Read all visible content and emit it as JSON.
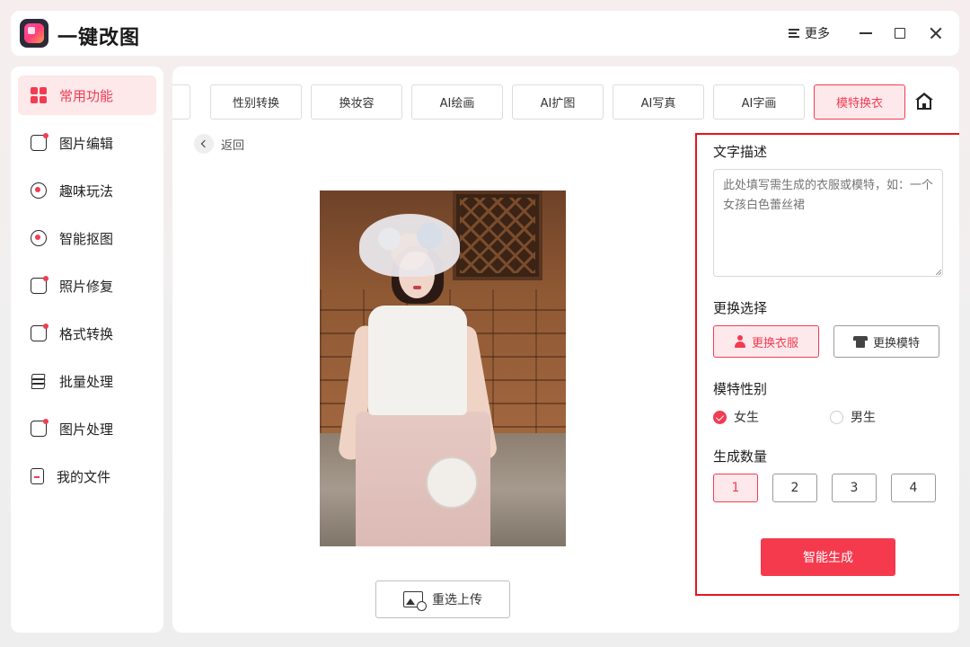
{
  "app": {
    "title": "一键改图",
    "more_label": "更多"
  },
  "sidebar": {
    "items": [
      {
        "label": "常用功能",
        "icon": "grid-icon",
        "active": true
      },
      {
        "label": "图片编辑",
        "icon": "edit-icon"
      },
      {
        "label": "趣味玩法",
        "icon": "magic-wand-icon"
      },
      {
        "label": "智能抠图",
        "icon": "target-icon"
      },
      {
        "label": "照片修复",
        "icon": "repair-icon"
      },
      {
        "label": "格式转换",
        "icon": "convert-icon"
      },
      {
        "label": "批量处理",
        "icon": "layers-icon"
      },
      {
        "label": "图片处理",
        "icon": "image-icon"
      },
      {
        "label": "我的文件",
        "icon": "file-icon"
      }
    ]
  },
  "tabs": [
    {
      "label": "性别转换"
    },
    {
      "label": "换妆容"
    },
    {
      "label": "AI绘画"
    },
    {
      "label": "AI扩图"
    },
    {
      "label": "AI写真"
    },
    {
      "label": "AI字画"
    },
    {
      "label": "模特换衣",
      "active": true
    }
  ],
  "back_label": "返回",
  "reupload_label": "重选上传",
  "settings": {
    "text_desc_title": "文字描述",
    "text_desc_placeholder": "此处填写需生成的衣服或模特，如：一个女孩白色蕾丝裙",
    "replace_title": "更换选择",
    "replace_options": [
      {
        "label": "更换衣服",
        "icon": "person-icon",
        "active": true
      },
      {
        "label": "更换模特",
        "icon": "shirt-icon"
      }
    ],
    "gender_title": "模特性别",
    "genders": [
      {
        "label": "女生",
        "checked": true
      },
      {
        "label": "男生",
        "checked": false
      }
    ],
    "count_title": "生成数量",
    "counts": [
      "1",
      "2",
      "3",
      "4"
    ],
    "selected_count": "1",
    "generate_label": "智能生成"
  },
  "colors": {
    "accent": "#f23c52",
    "highlight_border": "#e8141f"
  }
}
